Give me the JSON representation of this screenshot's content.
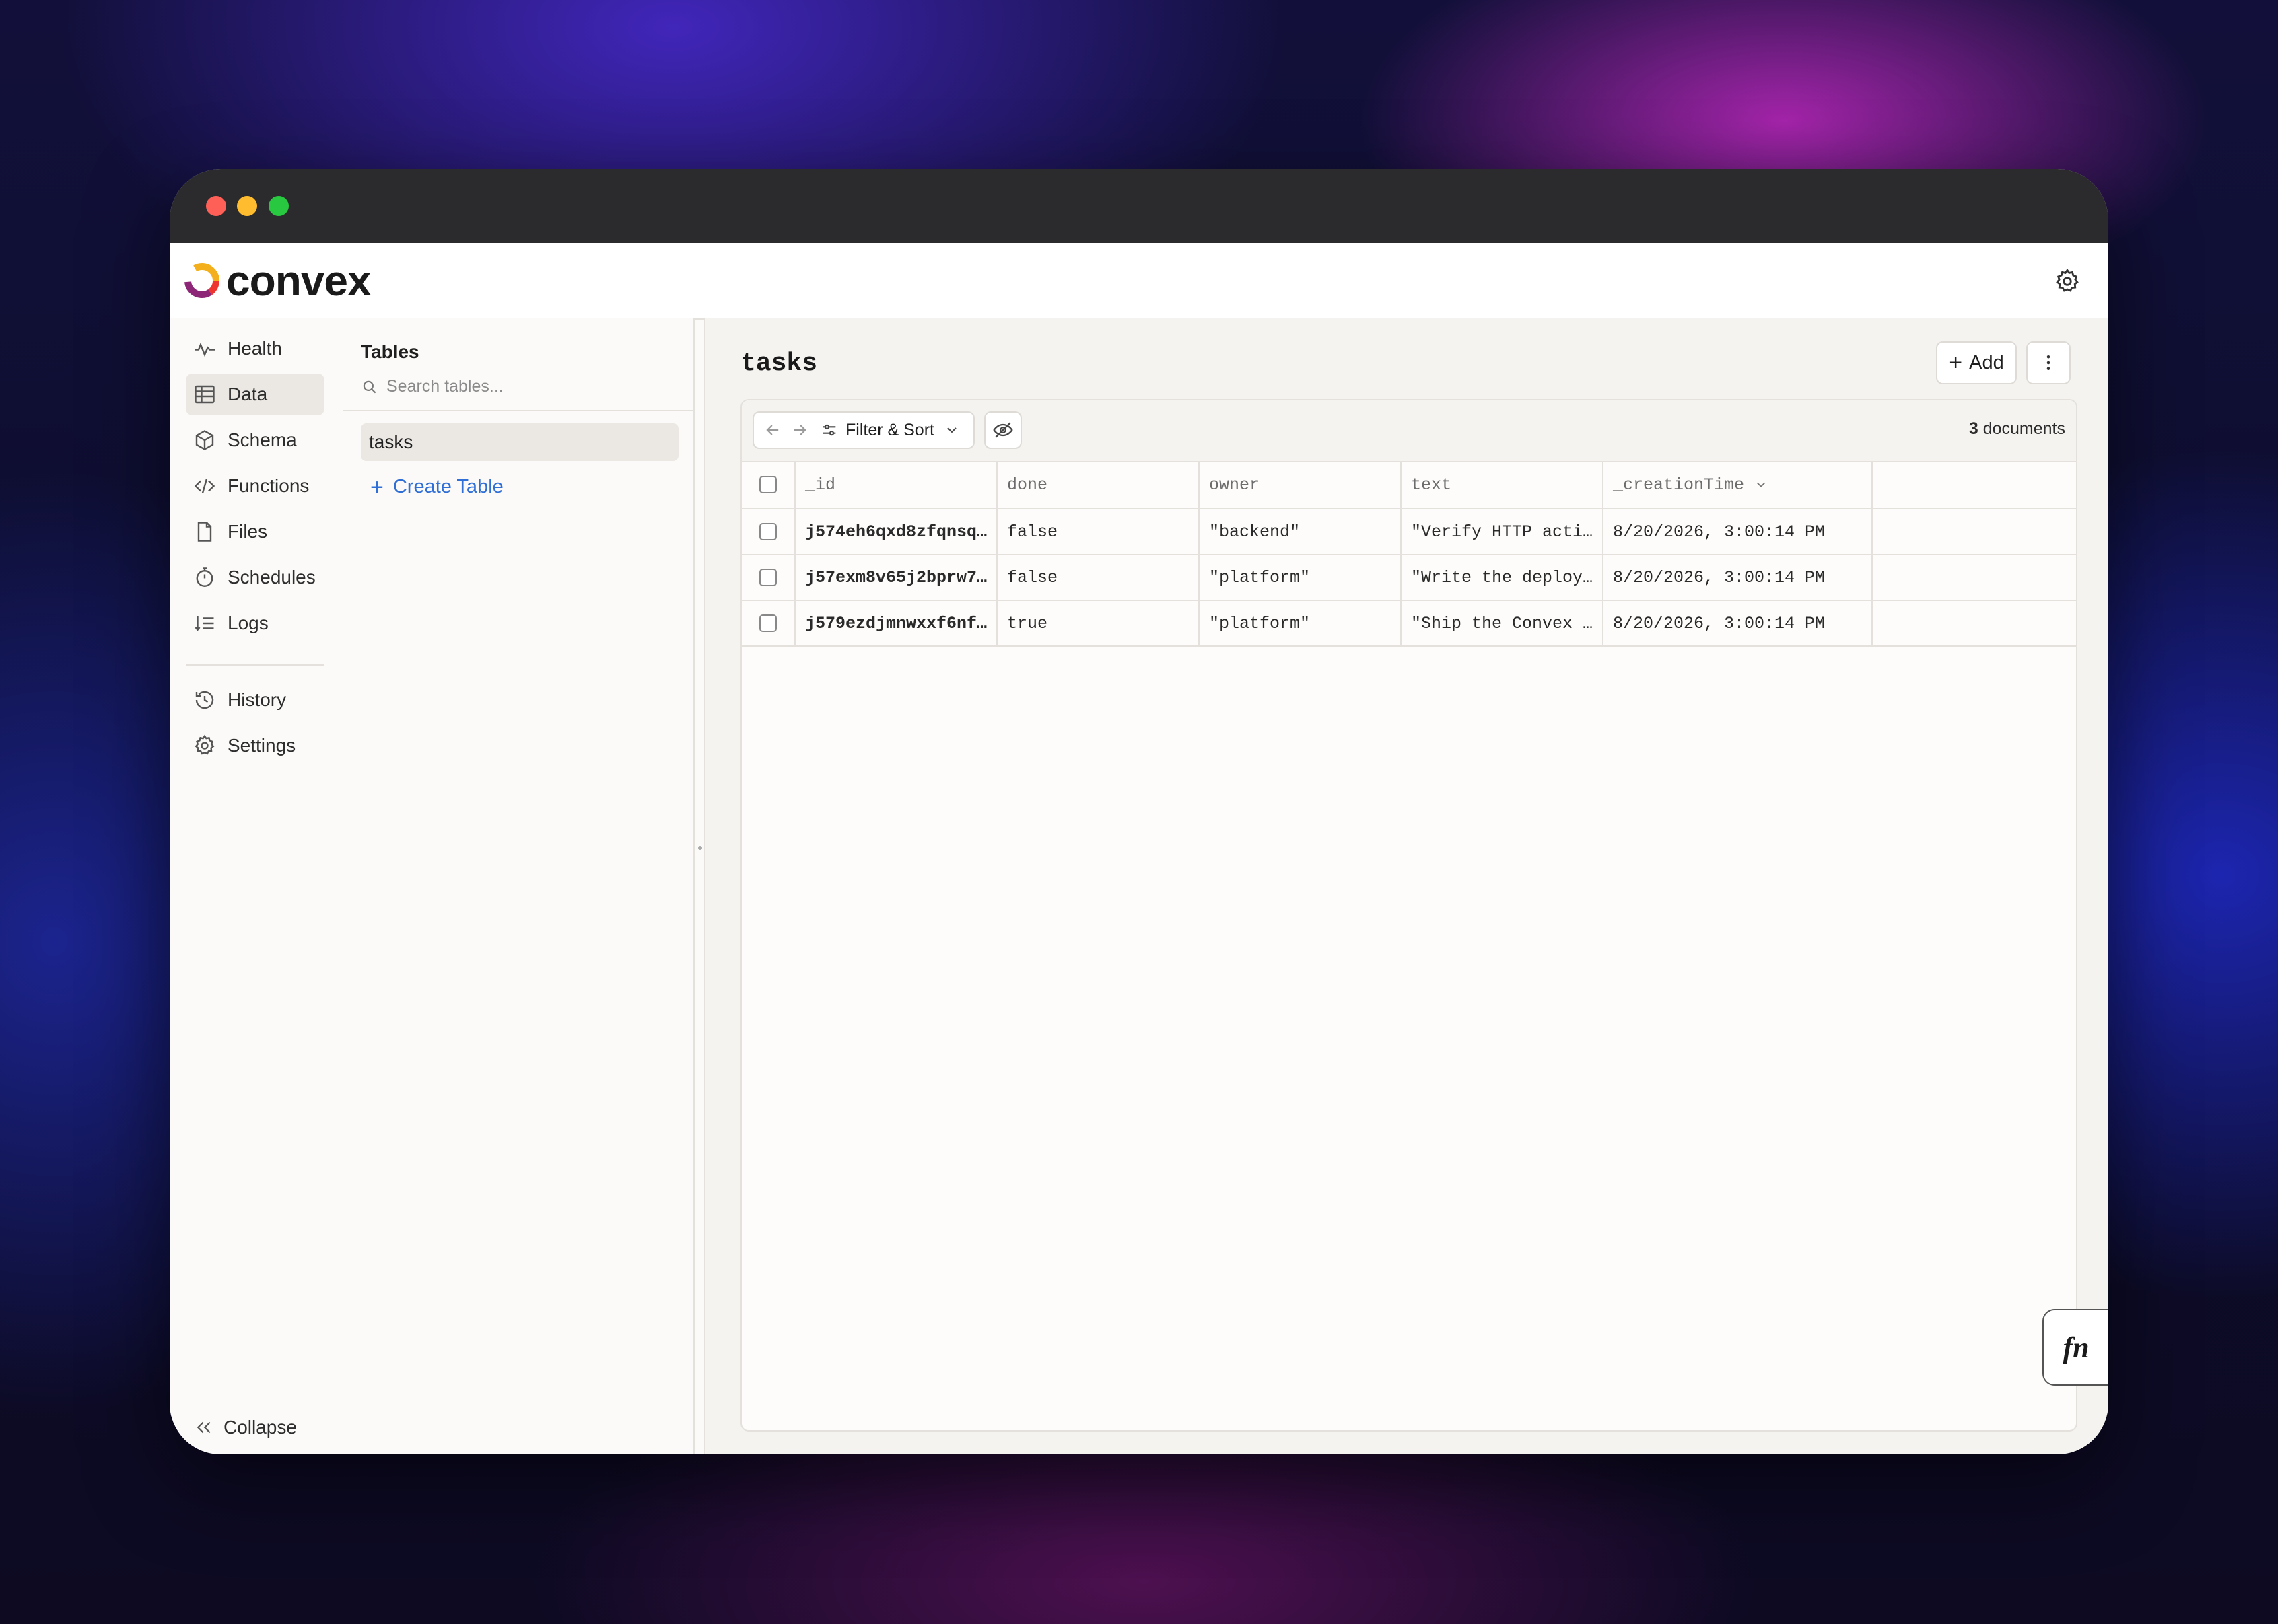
{
  "app": {
    "name": "convex"
  },
  "nav": {
    "items": [
      {
        "label": "Health",
        "icon": "pulse-icon"
      },
      {
        "label": "Data",
        "icon": "table-icon",
        "active": true
      },
      {
        "label": "Schema",
        "icon": "cube-icon"
      },
      {
        "label": "Functions",
        "icon": "code-icon"
      },
      {
        "label": "Files",
        "icon": "file-icon"
      },
      {
        "label": "Schedules",
        "icon": "stopwatch-icon"
      },
      {
        "label": "Logs",
        "icon": "logs-icon"
      }
    ],
    "secondary": [
      {
        "label": "History",
        "icon": "history-icon"
      },
      {
        "label": "Settings",
        "icon": "gear-icon"
      }
    ],
    "collapse_label": "Collapse"
  },
  "tables_panel": {
    "heading": "Tables",
    "search_placeholder": "Search tables...",
    "tables": [
      "tasks"
    ],
    "selected": "tasks",
    "create_label": "Create Table"
  },
  "main": {
    "title": "tasks",
    "add_label": "Add",
    "toolbar": {
      "filter_label": "Filter & Sort",
      "document_count": "3",
      "document_label": "documents"
    },
    "columns": [
      "_id",
      "done",
      "owner",
      "text",
      "_creationTime"
    ],
    "sort_column": "_creationTime",
    "rows": [
      {
        "_id": "j574eh6qxd8zfqnsqv…",
        "done": "false",
        "owner": "\"backend\"",
        "text": "\"Verify HTTP actio…",
        "_creationTime": "8/20/2026, 3:00:14 PM"
      },
      {
        "_id": "j57exm8v65j2bprw7h…",
        "done": "false",
        "owner": "\"platform\"",
        "text": "\"Write the deploym…",
        "_creationTime": "8/20/2026, 3:00:14 PM"
      },
      {
        "_id": "j579ezdjmnwxxf6nfa…",
        "done": "true",
        "owner": "\"platform\"",
        "text": "\"Ship the Convex R…",
        "_creationTime": "8/20/2026, 3:00:14 PM"
      }
    ]
  },
  "fn_button_label": "fn",
  "colors": {
    "accent": "#2f6fd6",
    "sidebar_active": "#ebe8e4",
    "titlebar": "#2b2b2e"
  }
}
